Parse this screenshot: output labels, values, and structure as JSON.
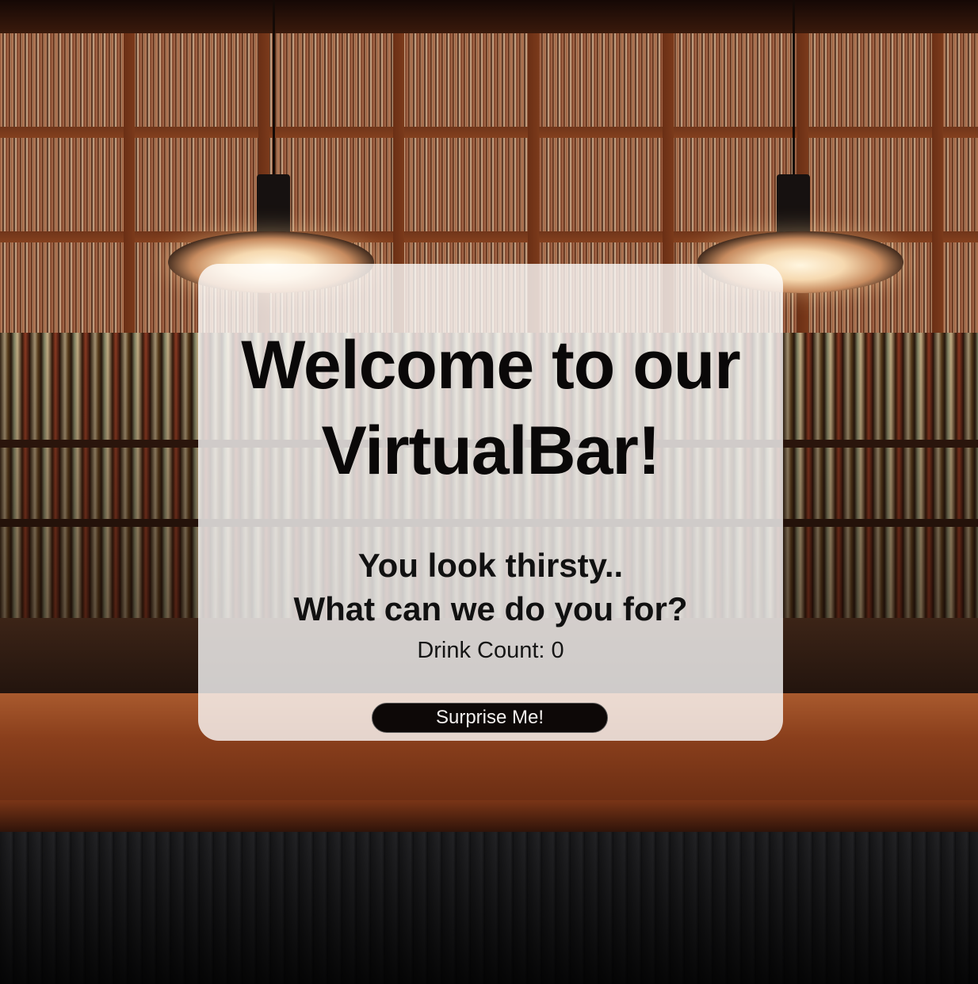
{
  "page": {
    "title_line_1": "Welcome to our",
    "title_line_2": "VirtualBar!",
    "subtitle_line_1": "You look thirsty..",
    "subtitle_line_2": "What can we do you for?",
    "drink_count_label": "Drink Count: 0",
    "surprise_button_label": "Surprise Me!"
  },
  "colors": {
    "card_background": "#ffffffc7",
    "text": "#0a0808",
    "button_background": "#0d0807",
    "button_text": "#f4f0ee"
  },
  "background": {
    "description_icon": "bar-interior-photo"
  }
}
